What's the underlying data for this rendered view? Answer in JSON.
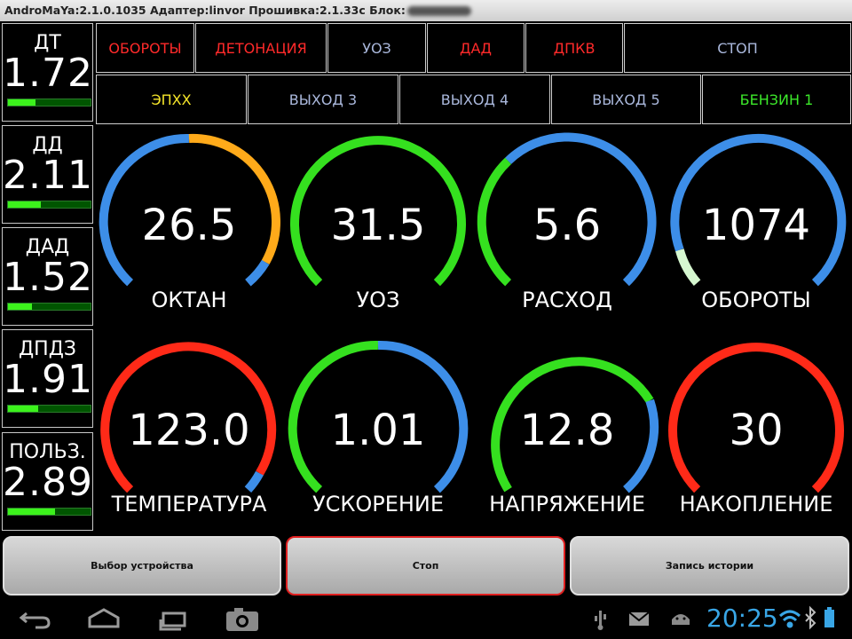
{
  "titlebar": {
    "text": "AndroMaYa:2.1.0.1035 Адаптер:linvor  Прошивка:2.1.33c  Блок:"
  },
  "sensors": [
    {
      "label": "ДТ",
      "value": "1.72",
      "level": 0.33
    },
    {
      "label": "ДД",
      "value": "2.11",
      "level": 0.4
    },
    {
      "label": "ДАД",
      "value": "1.52",
      "level": 0.29
    },
    {
      "label": "ДПДЗ",
      "value": "1.91",
      "level": 0.37
    },
    {
      "label": "ПОЛЬЗ.",
      "value": "2.89",
      "level": 0.57
    }
  ],
  "status_row1": [
    {
      "label": "ОБОРОТЫ",
      "color": "#ff2a2a"
    },
    {
      "label": "ДЕТОНАЦИЯ",
      "color": "#ff2a2a"
    },
    {
      "label": "УОЗ",
      "color": "#aab8dc"
    },
    {
      "label": "ДАД",
      "color": "#ff2a2a"
    },
    {
      "label": "ДПКВ",
      "color": "#ff2a2a"
    },
    {
      "label": "СТОП",
      "color": "#aab8dc"
    }
  ],
  "status_row2": [
    {
      "label": "ЭПХХ",
      "color": "#f5e52a"
    },
    {
      "label": "ВЫХОД 3",
      "color": "#aab8dc"
    },
    {
      "label": "ВЫХОД 4",
      "color": "#aab8dc"
    },
    {
      "label": "ВЫХОД 5",
      "color": "#aab8dc"
    },
    {
      "label": "БЕНЗИН 1",
      "color": "#3ce82a"
    }
  ],
  "gauges": [
    {
      "name": "ОКТАН",
      "value": "26.5"
    },
    {
      "name": "УОЗ",
      "value": "31.5"
    },
    {
      "name": "РАСХОД",
      "value": "5.6"
    },
    {
      "name": "ОБОРОТЫ",
      "value": "1074"
    },
    {
      "name": "ТЕМПЕРАТУРА",
      "value": "123.0"
    },
    {
      "name": "УСКОРЕНИЕ",
      "value": "1.01"
    },
    {
      "name": "НАПРЯЖЕНИЕ",
      "value": "12.8"
    },
    {
      "name": "НАКОПЛЕНИЕ",
      "value": "30"
    }
  ],
  "bottom_buttons": {
    "device": "Выбор устройства",
    "stop": "Стоп",
    "history": "Запись истории"
  },
  "statusbar": {
    "time": "20:25"
  },
  "colors": {
    "blue": "#3d8ee8",
    "green": "#35e01f",
    "orange": "#ffaa1a",
    "red": "#ff2a18",
    "pale_green": "#d6f7d0",
    "stop_border": "#e02020"
  }
}
